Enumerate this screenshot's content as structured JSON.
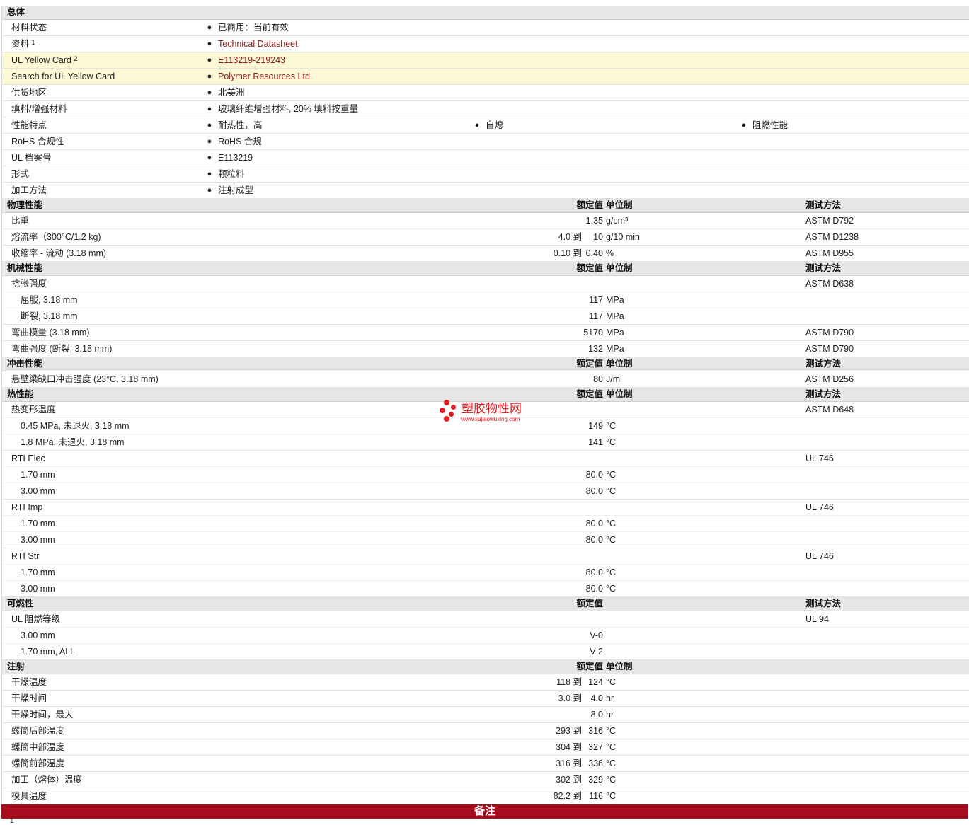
{
  "general": {
    "title": "总体",
    "status_label": "材料状态",
    "status_value": "已商用：当前有效",
    "docs_label": "资料",
    "docs_sup": "1",
    "docs_value": "Technical Datasheet",
    "ulcard_label": "UL Yellow Card",
    "ulcard_sup": "2",
    "ulcard_value": "E113219-219243",
    "search_label": "Search for UL Yellow Card",
    "search_value": "Polymer Resources Ltd.",
    "region_label": "供货地区",
    "region_value": "北美洲",
    "filler_label": "填料/增强材料",
    "filler_value": "玻璃纤维增强材料, 20% 填料按重量",
    "features_label": "性能特点",
    "features_values": [
      "耐热性，高",
      "自熄",
      "阻燃性能"
    ],
    "rohs_label": "RoHS 合规性",
    "rohs_value": "RoHS 合规",
    "ulfile_label": "UL 档案号",
    "ulfile_value": "E113219",
    "form_label": "形式",
    "form_value": "颗粒料",
    "process_label": "加工方法",
    "process_value": "注射成型"
  },
  "physical": {
    "title": "物理性能",
    "h_nom": "额定值",
    "h_unit": "单位制",
    "h_test": "测试方法",
    "rows": [
      {
        "label": "比重",
        "nom": "1.35",
        "unit": "g/cm³",
        "test": "ASTM D792"
      },
      {
        "label": "熔流率（300°C/1.2 kg)",
        "from": "4.0 到",
        "nom": "10",
        "unit": "g/10 min",
        "test": "ASTM D1238"
      },
      {
        "label": "收缩率 - 流动 (3.18 mm)",
        "from": "0.10 到",
        "nom": "0.40",
        "unit": "%",
        "test": "ASTM D955"
      }
    ]
  },
  "mechanical": {
    "title": "机械性能",
    "h_nom": "额定值",
    "h_unit": "单位制",
    "h_test": "测试方法",
    "tensile_label": "抗张强度",
    "tensile_test": "ASTM D638",
    "yield_label": "屈服, 3.18 mm",
    "yield_nom": "117",
    "yield_unit": "MPa",
    "break_label": "断裂, 3.18 mm",
    "break_nom": "117",
    "break_unit": "MPa",
    "fmod_label": "弯曲模量 (3.18 mm)",
    "fmod_nom": "5170",
    "fmod_unit": "MPa",
    "fmod_test": "ASTM D790",
    "fstr_label": "弯曲强度 (断裂, 3.18 mm)",
    "fstr_nom": "132",
    "fstr_unit": "MPa",
    "fstr_test": "ASTM D790"
  },
  "impact": {
    "title": "冲击性能",
    "h_nom": "额定值",
    "h_unit": "单位制",
    "h_test": "测试方法",
    "izod_label": "悬壁梁缺口冲击强度 (23°C, 3.18 mm)",
    "izod_nom": "80",
    "izod_unit": "J/m",
    "izod_test": "ASTM D256"
  },
  "thermal": {
    "title": "热性能",
    "h_nom": "额定值",
    "h_unit": "单位制",
    "h_test": "测试方法",
    "hdt_label": "热变形温度",
    "hdt_test": "ASTM D648",
    "hdt1_label": "0.45 MPa, 未退火, 3.18 mm",
    "hdt1_nom": "149",
    "hdt1_unit": "°C",
    "hdt2_label": "1.8 MPa, 未退火, 3.18 mm",
    "hdt2_nom": "141",
    "hdt2_unit": "°C",
    "rti_elec_label": "RTI Elec",
    "rti_elec_test": "UL 746",
    "rti_elec_1_label": "1.70 mm",
    "rti_elec_1_nom": "80.0",
    "rti_elec_1_unit": "°C",
    "rti_elec_2_label": "3.00 mm",
    "rti_elec_2_nom": "80.0",
    "rti_elec_2_unit": "°C",
    "rti_imp_label": "RTI Imp",
    "rti_imp_test": "UL 746",
    "rti_imp_1_label": "1.70 mm",
    "rti_imp_1_nom": "80.0",
    "rti_imp_1_unit": "°C",
    "rti_imp_2_label": "3.00 mm",
    "rti_imp_2_nom": "80.0",
    "rti_imp_2_unit": "°C",
    "rti_str_label": "RTI Str",
    "rti_str_test": "UL 746",
    "rti_str_1_label": "1.70 mm",
    "rti_str_1_nom": "80.0",
    "rti_str_1_unit": "°C",
    "rti_str_2_label": "3.00 mm",
    "rti_str_2_nom": "80.0",
    "rti_str_2_unit": "°C"
  },
  "flammability": {
    "title": "可燃性",
    "h_nom": "额定值",
    "h_test": "测试方法",
    "ul94_label": "UL 阻燃等级",
    "ul94_test": "UL 94",
    "ul94_1_label": "3.00 mm",
    "ul94_1_nom": "V-0",
    "ul94_2_label": "1.70 mm, ALL",
    "ul94_2_nom": "V-2"
  },
  "injection": {
    "title": "注射",
    "h_nom": "额定值",
    "h_unit": "单位制",
    "rows": [
      {
        "label": "干燥温度",
        "from": "118 到",
        "nom": "124",
        "unit": "°C"
      },
      {
        "label": "干燥时间",
        "from": "3.0 到",
        "nom": "4.0",
        "unit": "hr"
      },
      {
        "label": "干燥时间，最大",
        "nom": "8.0",
        "unit": "hr"
      },
      {
        "label": "螺筒后部温度",
        "from": "293 到",
        "nom": "316",
        "unit": "°C"
      },
      {
        "label": "螺筒中部温度",
        "from": "304 到",
        "nom": "327",
        "unit": "°C"
      },
      {
        "label": "螺筒前部温度",
        "from": "316 到",
        "nom": "338",
        "unit": "°C"
      },
      {
        "label": "加工（熔体）温度",
        "from": "302 到",
        "nom": "329",
        "unit": "°C"
      },
      {
        "label": "模具温度",
        "from": "82.2 到",
        "nom": "116",
        "unit": "°C"
      }
    ]
  },
  "notes": {
    "title": "备注",
    "marker": "1"
  },
  "watermark": {
    "name": "塑胶物性网",
    "url": "www.sujiaowuxing.com",
    "color": "#e61e24"
  },
  "colors": {
    "accent": "#a50d1f",
    "link": "#8b1a1a",
    "highlight": "#fcf7d4",
    "section": "#e6e6e6"
  }
}
